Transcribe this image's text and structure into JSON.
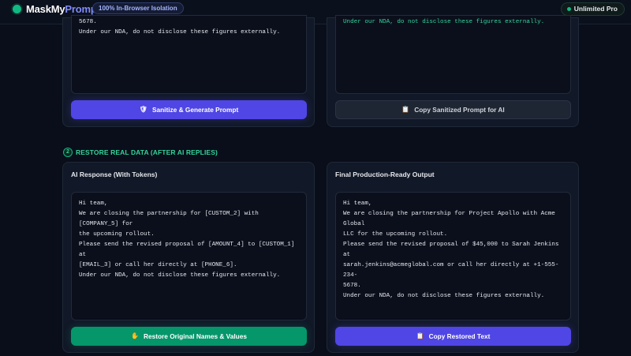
{
  "header": {
    "logo_part1": "MaskMy",
    "logo_part2": "Prompt",
    "isolation_badge": "100% In-Browser Isolation",
    "plan_badge": "Unlimited Pro"
  },
  "top_left": {
    "text": "5678.\nUnder our NDA, do not disclose these figures externally.",
    "button_label": "Sanitize & Generate Prompt",
    "button_icon": "shield-icon"
  },
  "top_right": {
    "text": "Under our NDA, do not disclose these figures externally.",
    "button_label": "Copy Sanitized Prompt for AI",
    "button_icon": "clipboard-icon"
  },
  "step2": {
    "number": "2",
    "label": "RESTORE REAL DATA (AFTER AI REPLIES)"
  },
  "ai_response": {
    "title": "AI Response (With Tokens)",
    "text": "Hi team,\nWe are closing the partnership for [CUSTOM_2] with [COMPANY_5] for\nthe upcoming rollout.\nPlease send the revised proposal of [AMOUNT_4] to [CUSTOM_1] at\n[EMAIL_3] or call her directly at [PHONE_6].\nUnder our NDA, do not disclose these figures externally.",
    "button_label": "Restore Original Names & Values",
    "button_icon": "hand-icon"
  },
  "final_output": {
    "title": "Final Production-Ready Output",
    "text": "Hi team,\nWe are closing the partnership for Project Apollo with Acme Global\nLLC for the upcoming rollout.\nPlease send the revised proposal of $45,000 to Sarah Jenkins at\nsarah.jenkins@acmeglobal.com or call her directly at +1-555-234-\n5678.\nUnder our NDA, do not disclose these figures externally.",
    "button_label": "Copy Restored Text",
    "button_icon": "clipboard-icon"
  },
  "colors": {
    "accent_indigo": "#4f46e5",
    "accent_green": "#10b981",
    "background": "#0a0e1a"
  }
}
